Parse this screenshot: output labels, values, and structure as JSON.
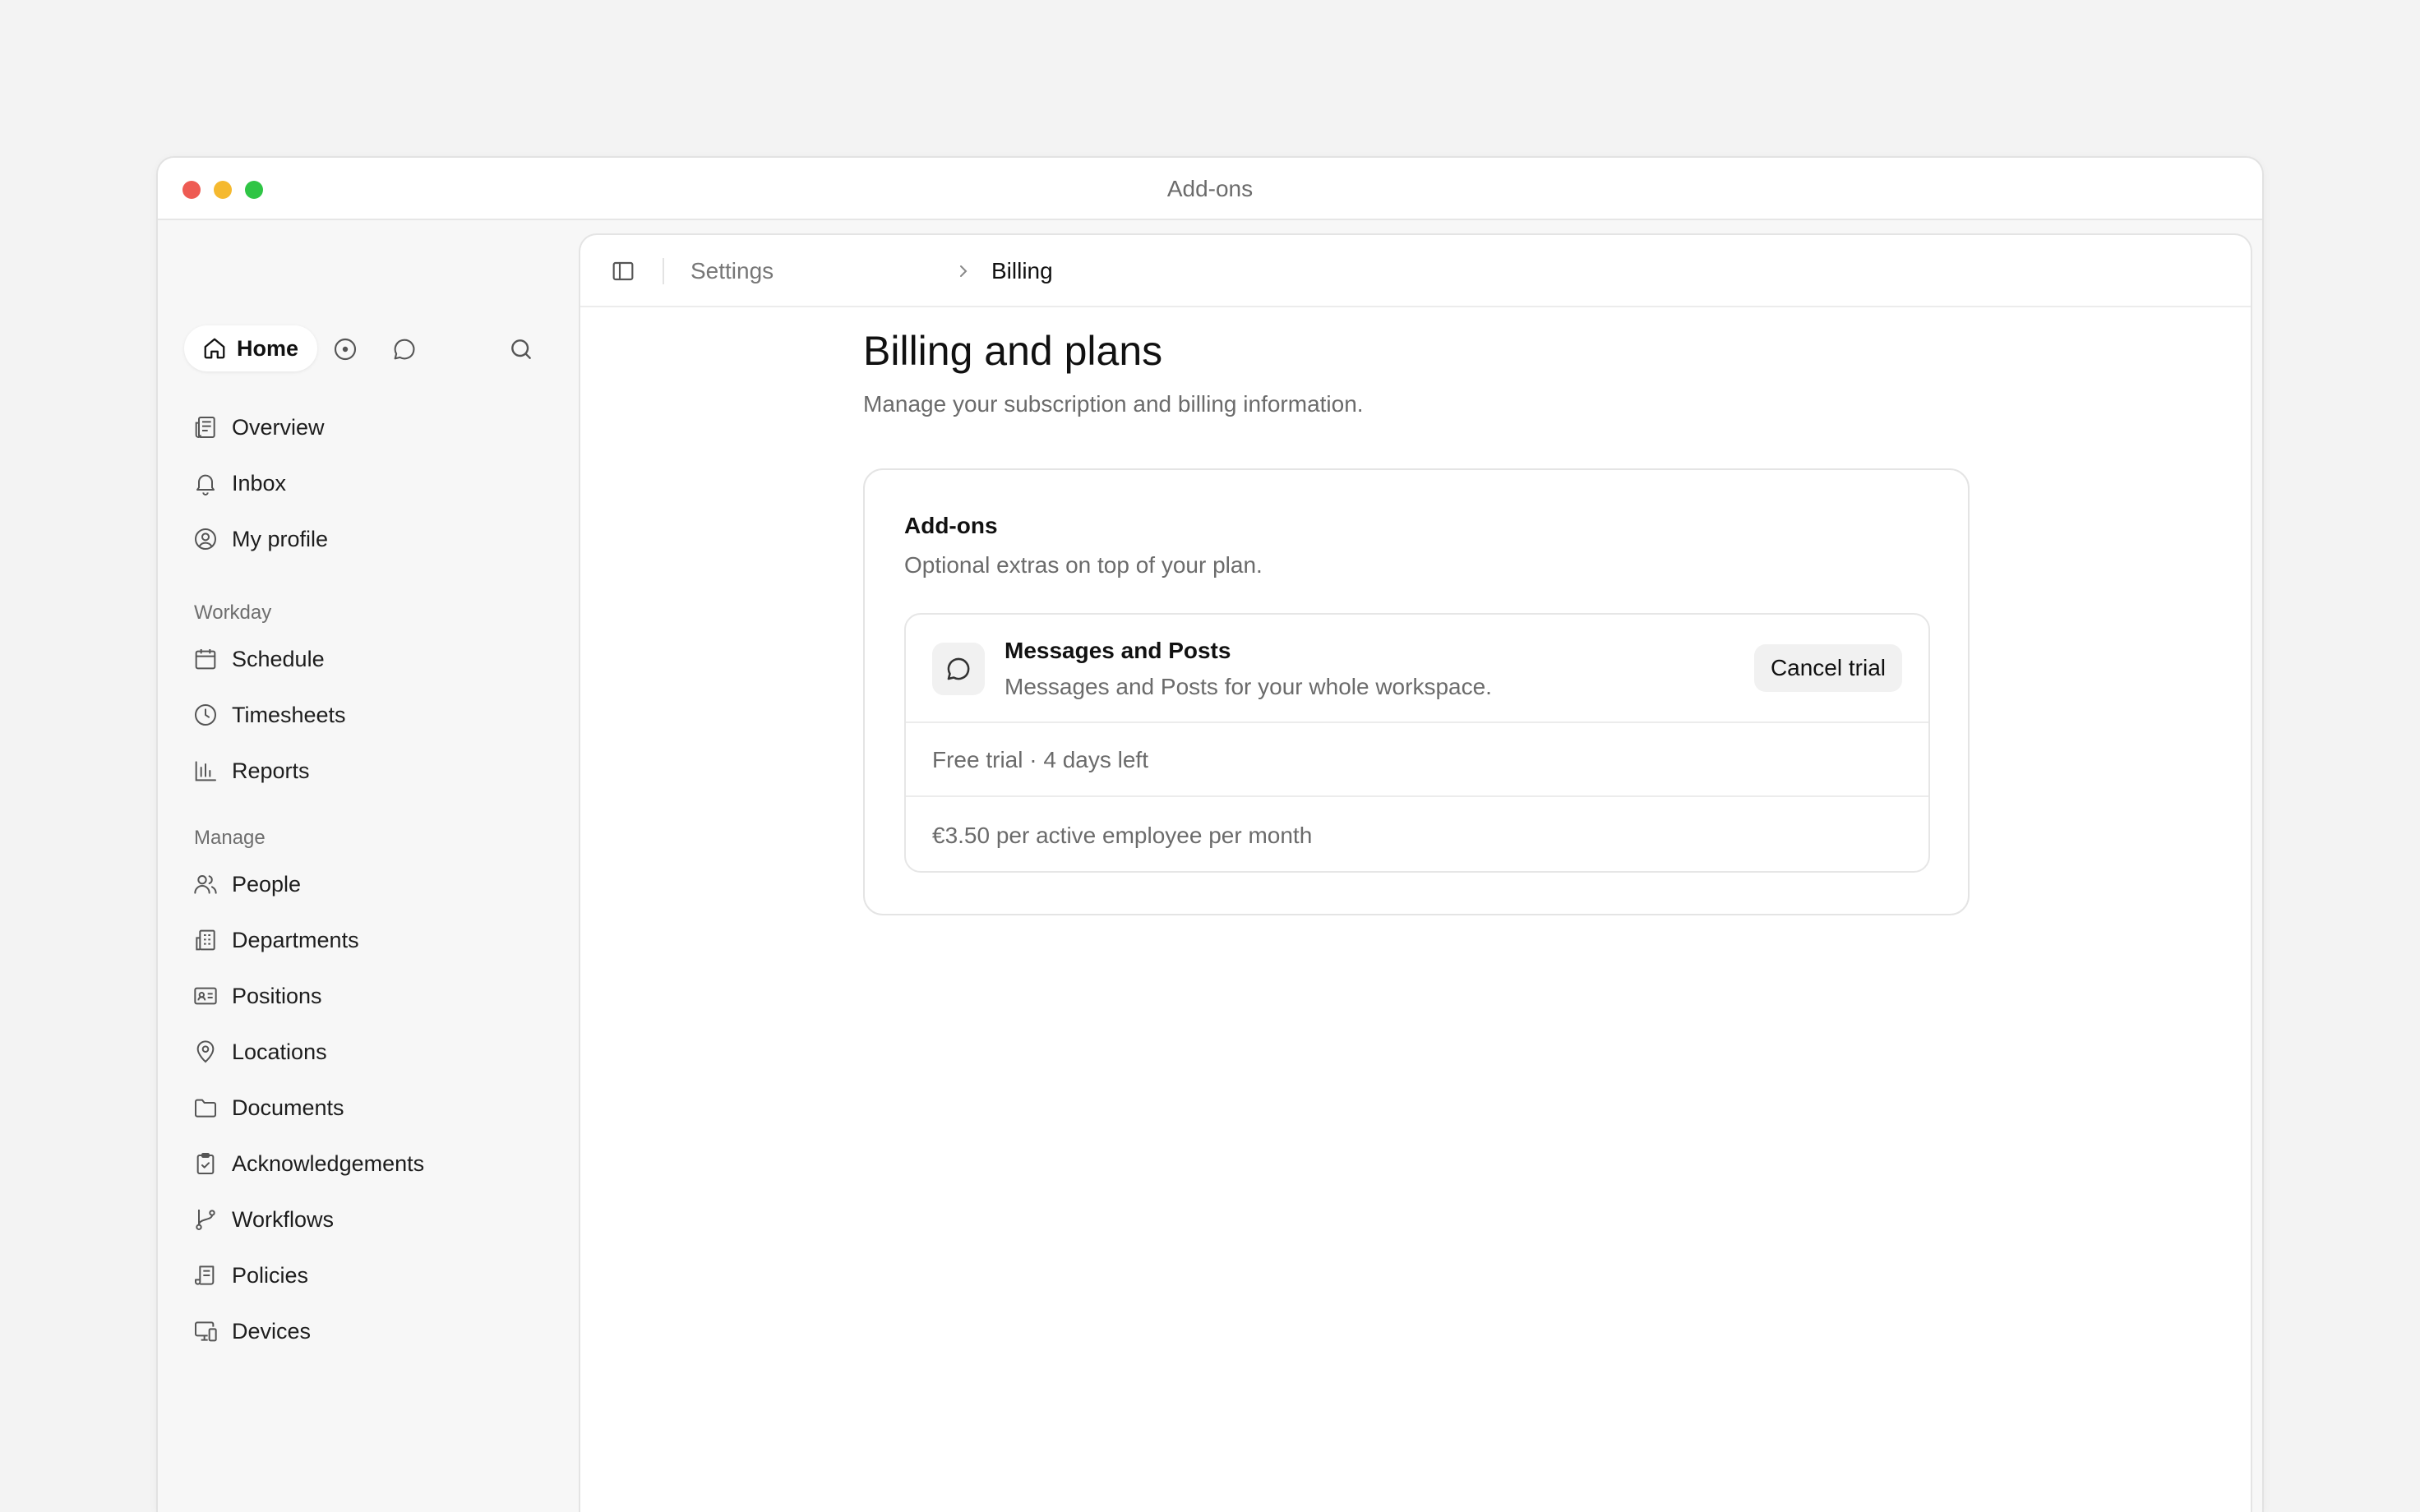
{
  "window": {
    "title": "Add-ons"
  },
  "sidebar": {
    "home_label": "Home",
    "primary_items": [
      {
        "label": "Overview",
        "icon": "newspaper-icon"
      },
      {
        "label": "Inbox",
        "icon": "bell-icon"
      },
      {
        "label": "My profile",
        "icon": "user-circle-icon"
      }
    ],
    "sections": [
      {
        "label": "Workday",
        "items": [
          {
            "label": "Schedule",
            "icon": "calendar-icon"
          },
          {
            "label": "Timesheets",
            "icon": "clock-icon"
          },
          {
            "label": "Reports",
            "icon": "bar-chart-icon"
          }
        ]
      },
      {
        "label": "Manage",
        "items": [
          {
            "label": "People",
            "icon": "users-icon"
          },
          {
            "label": "Departments",
            "icon": "building-icon"
          },
          {
            "label": "Positions",
            "icon": "id-card-icon"
          },
          {
            "label": "Locations",
            "icon": "map-pin-icon"
          },
          {
            "label": "Documents",
            "icon": "folder-icon"
          },
          {
            "label": "Acknowledgements",
            "icon": "clipboard-check-icon"
          },
          {
            "label": "Workflows",
            "icon": "git-branch-icon"
          },
          {
            "label": "Policies",
            "icon": "scroll-icon"
          },
          {
            "label": "Devices",
            "icon": "monitor-phone-icon"
          }
        ]
      }
    ]
  },
  "breadcrumb": {
    "parent": "Settings",
    "current": "Billing"
  },
  "page": {
    "title": "Billing and plans",
    "subtitle": "Manage your subscription and billing information."
  },
  "addons_card": {
    "title": "Add-ons",
    "subtitle": "Optional extras on top of your plan.",
    "addon": {
      "name": "Messages and Posts",
      "description": "Messages and Posts for your whole workspace.",
      "action_label": "Cancel trial",
      "trial_status": "Free trial · 4 days left",
      "price": "€3.50 per active employee per month"
    }
  }
}
